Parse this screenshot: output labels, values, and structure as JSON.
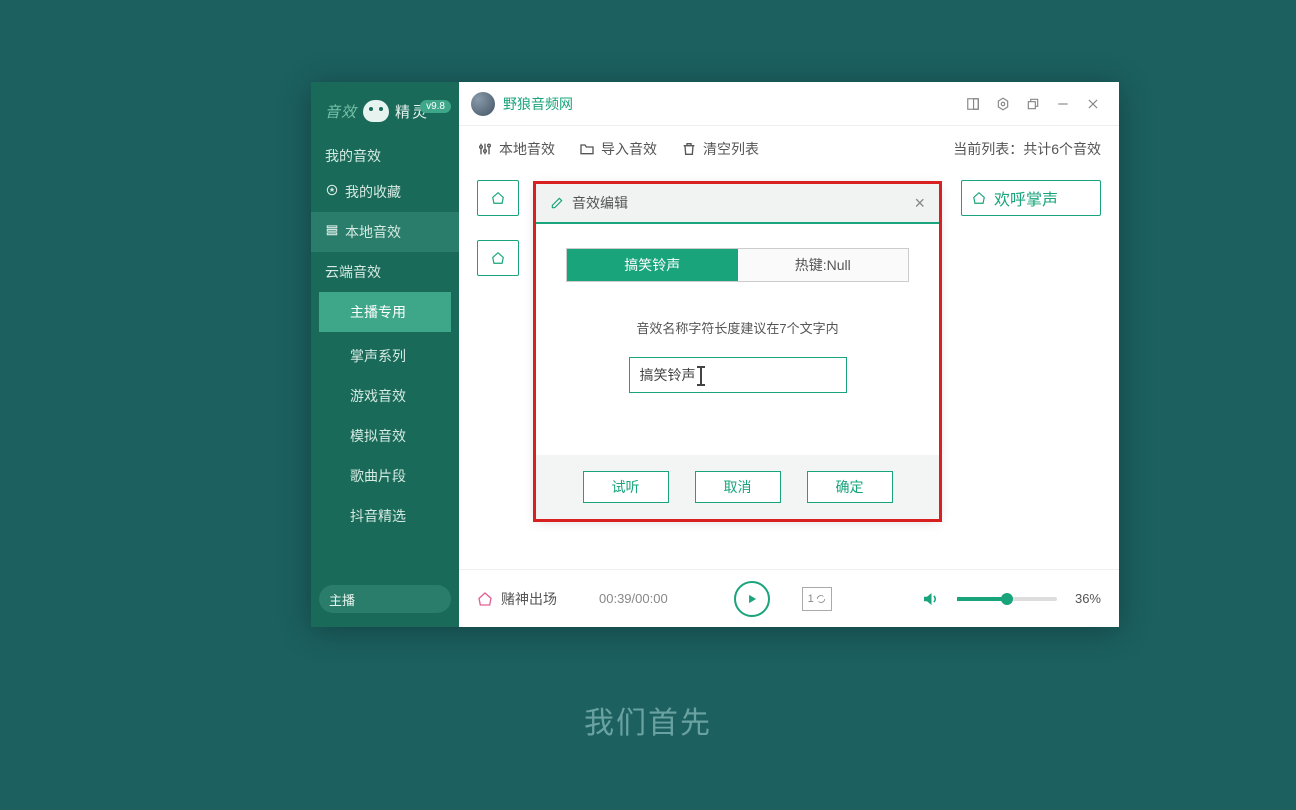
{
  "version_badge": "v9.8",
  "logo": {
    "left": "音效",
    "right": "精灵"
  },
  "sidebar": {
    "section1": "我的音效",
    "favorites": "我的收藏",
    "local": "本地音效",
    "section2": "云端音效",
    "items": [
      "主播专用",
      "掌声系列",
      "游戏音效",
      "模拟音效",
      "歌曲片段",
      "抖音精选"
    ]
  },
  "search_value": "主播",
  "titlebar": {
    "title": "野狼音频网"
  },
  "toolbar": {
    "local": "本地音效",
    "import": "导入音效",
    "clear": "清空列表",
    "count": "当前列表：共计6个音效"
  },
  "cards": {
    "right_visible": "欢呼掌声"
  },
  "modal": {
    "title": "音效编辑",
    "tab_active": "搞笑铃声",
    "tab_hotkey": "热键:Null",
    "hint": "音效名称字符长度建议在7个文字内",
    "input_value": "搞笑铃声",
    "btn_try": "试听",
    "btn_cancel": "取消",
    "btn_ok": "确定"
  },
  "player": {
    "now": "赌神出场",
    "time": "00:39/00:00",
    "loop": "1",
    "vol_pct": "36%",
    "vol_fill": "50"
  },
  "subtitle": "我们首先"
}
